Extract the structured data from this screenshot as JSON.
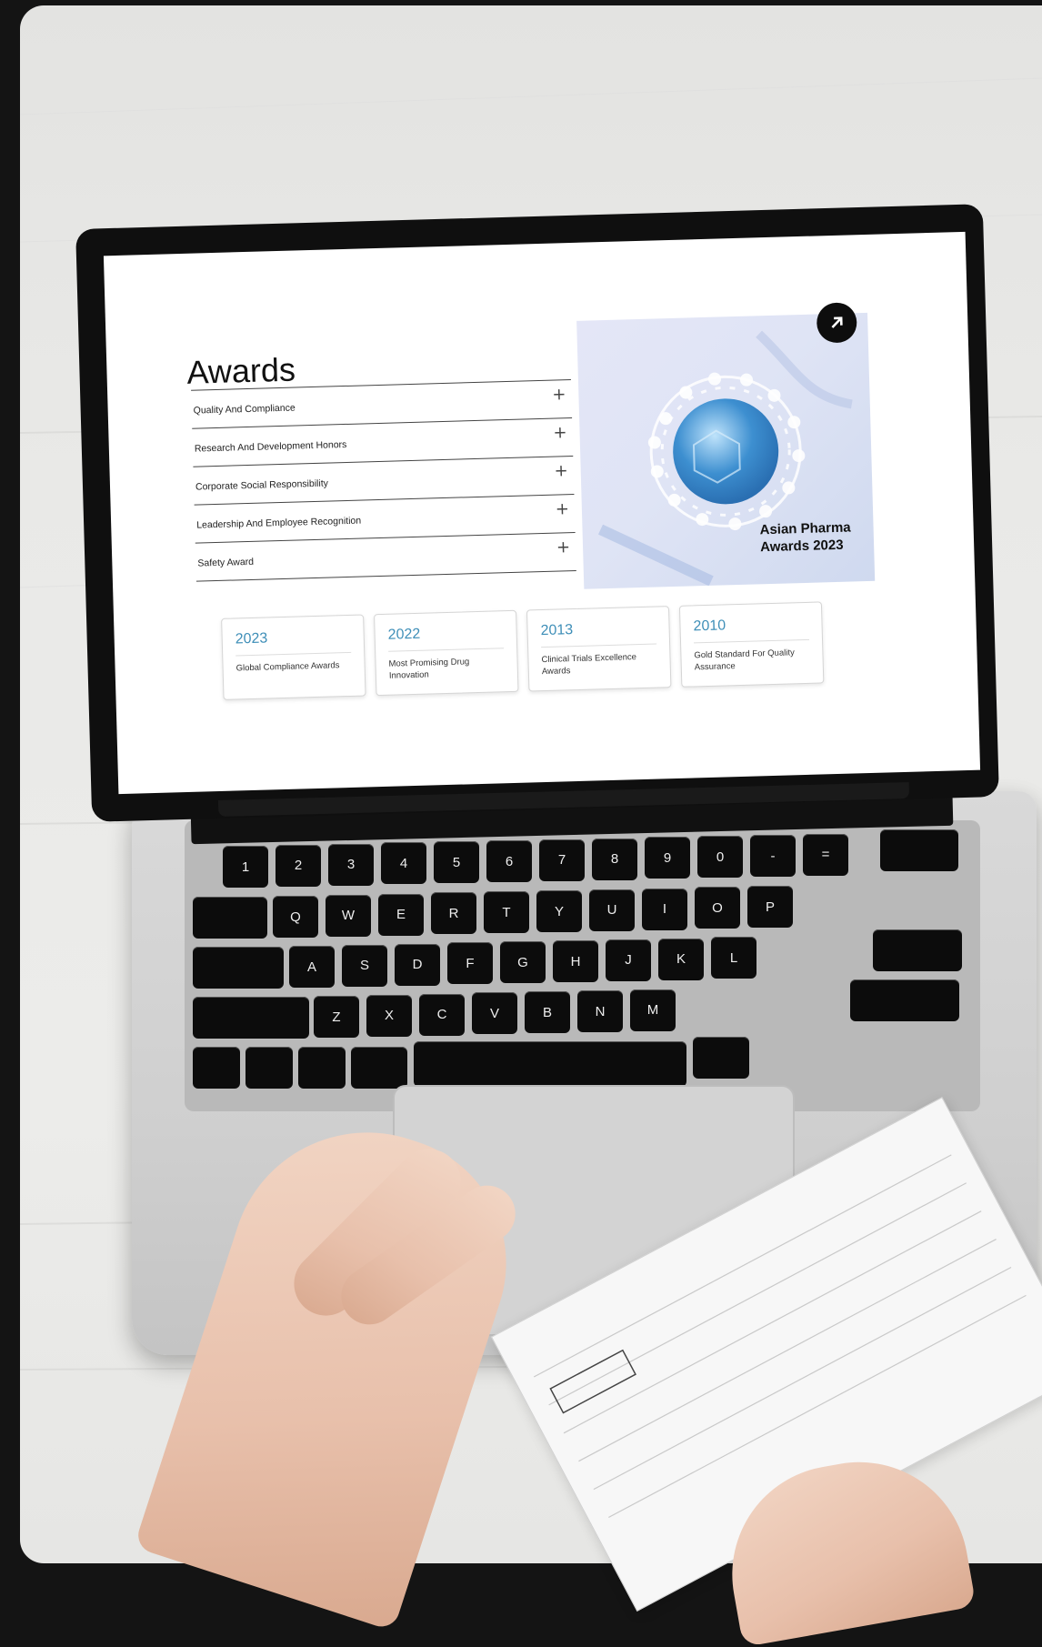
{
  "screen": {
    "title": "Awards",
    "accordion": [
      {
        "label": "Quality And Compliance",
        "icon": "plus-icon"
      },
      {
        "label": "Research And Development Honors",
        "icon": "plus-icon"
      },
      {
        "label": "Corporate Social Responsibility",
        "icon": "plus-icon"
      },
      {
        "label": "Leadership And Employee Recognition",
        "icon": "plus-icon"
      },
      {
        "label": "Safety Award",
        "icon": "plus-icon"
      }
    ],
    "feature": {
      "label_line1": "Asian Pharma",
      "label_line2": "Awards 2023",
      "button_icon": "arrow-up-right-icon"
    },
    "cards": [
      {
        "year": "2023",
        "text": "Global Compliance Awards"
      },
      {
        "year": "2022",
        "text": "Most Promising Drug Innovation"
      },
      {
        "year": "2013",
        "text": "Clinical Trials Excellence Awards"
      },
      {
        "year": "2010",
        "text": "Gold Standard For Quality Assurance"
      }
    ]
  },
  "keyboard": {
    "row1": [
      "1",
      "2",
      "3",
      "4",
      "5",
      "6",
      "7",
      "8",
      "9",
      "0",
      "-",
      "="
    ],
    "row2": [
      "Q",
      "W",
      "E",
      "R",
      "T",
      "Y",
      "U",
      "I",
      "O",
      "P"
    ],
    "row3": [
      "A",
      "S",
      "D",
      "F",
      "G",
      "H",
      "J",
      "K",
      "L"
    ],
    "row4": [
      "Z",
      "X",
      "C",
      "V",
      "B",
      "N",
      "M"
    ]
  },
  "colors": {
    "accent_year": "#3f8fb8",
    "background": "#141414",
    "table": "#e9e9e7"
  }
}
